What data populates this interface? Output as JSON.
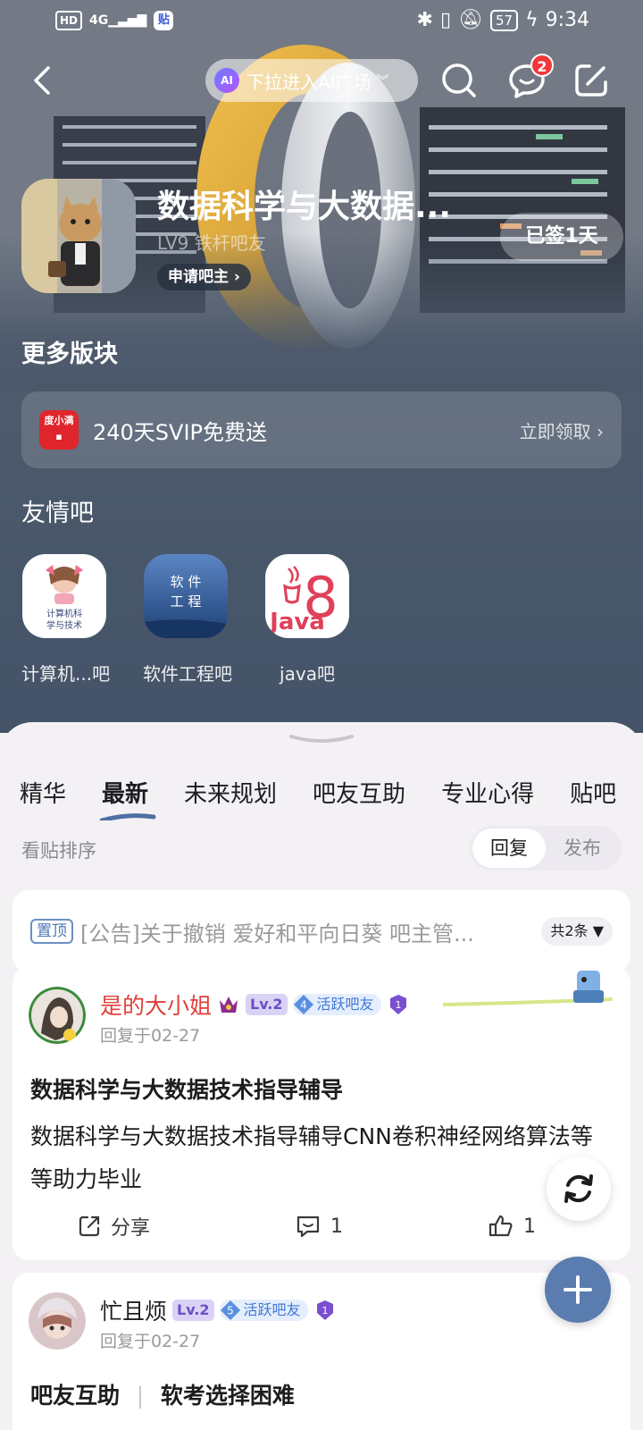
{
  "status_bar": {
    "network": "HD",
    "signal": "4G",
    "app_icon": "贴",
    "battery": "57",
    "time": "9:34"
  },
  "top_nav": {
    "ai_label": "下拉进入AI广场",
    "ai_logo": "AI",
    "message_badge": "2"
  },
  "forum": {
    "title": "数据科学与大数据...",
    "level": "LV9 铁杆吧友",
    "apply_label": "申请吧主",
    "signed_label": "已签1天"
  },
  "more_sections": {
    "title": "更多版块",
    "promo_icon": "度小满",
    "promo_text": "240天SVIP免费送",
    "promo_link": "立即领取"
  },
  "friend_forums": {
    "title": "友情吧",
    "items": [
      {
        "name": "计算机...吧",
        "logo_text": "计算机科学与技术"
      },
      {
        "name": "软件工程吧",
        "logo_text": "软件工程"
      },
      {
        "name": "java吧",
        "logo_text": "Java"
      }
    ]
  },
  "tabs": [
    "精华",
    "最新",
    "未来规划",
    "吧友互助",
    "专业心得",
    "贴吧"
  ],
  "active_tab": "最新",
  "sort": {
    "label": "看贴排序",
    "options": [
      "回复",
      "发布"
    ],
    "active": "回复"
  },
  "pinned": {
    "tag": "置顶",
    "text": "[公告]关于撤销 爱好和平向日葵 吧主管...",
    "count": "共2条"
  },
  "posts": [
    {
      "author": "是的大小姐",
      "level": "Lv.2",
      "rank": "4",
      "badge": "活跃吧友",
      "meta": "回复于02-27",
      "title": "数据科学与大数据技术指导辅导",
      "body": "数据科学与大数据技术指导辅导CNN卷积神经网络算法等等助力毕业",
      "share_label": "分享",
      "comments": "1",
      "likes": "1"
    },
    {
      "author": "忙且烦",
      "level": "Lv.2",
      "rank": "5",
      "badge": "活跃吧友",
      "meta": "回复于02-27",
      "title_prefix": "吧友互助",
      "title": "软考选择困难"
    }
  ],
  "colors": {
    "accent": "#5a7cae",
    "header_bg": "#4d5a6c",
    "author_red": "#e0403a",
    "badge_red": "#f0383b"
  }
}
